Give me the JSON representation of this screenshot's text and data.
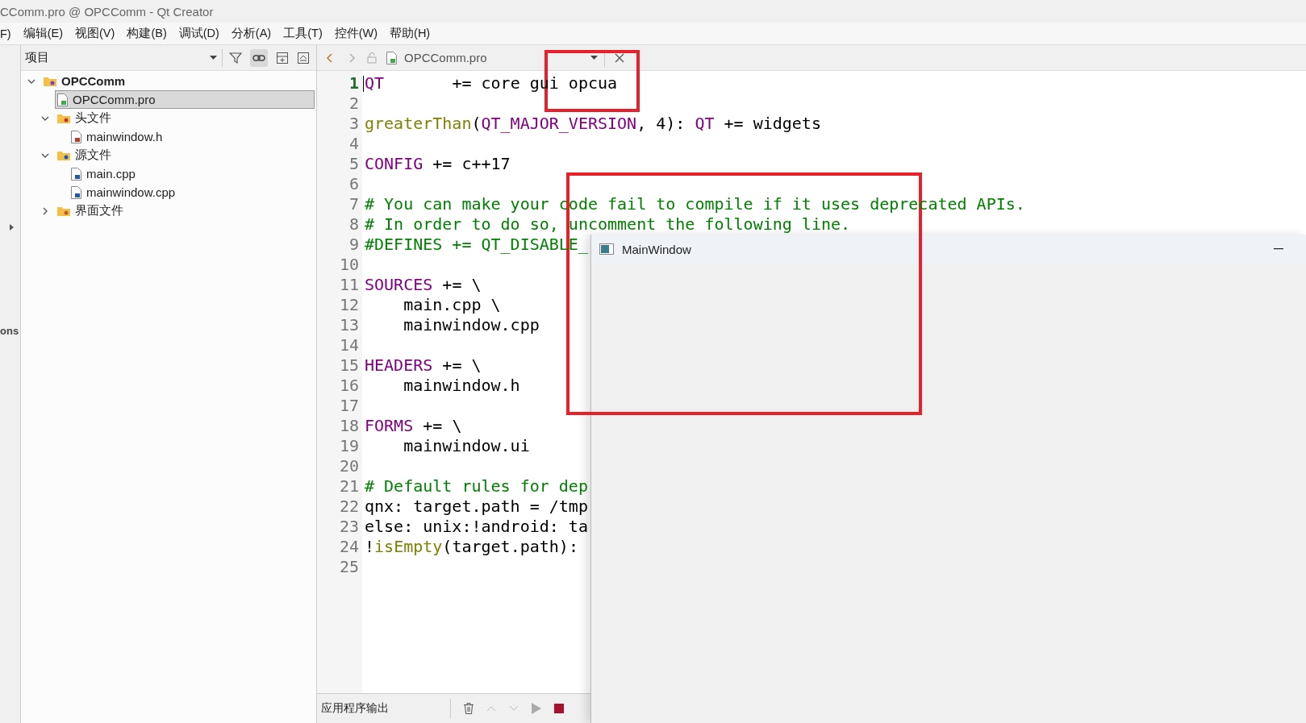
{
  "window": {
    "title": "CComm.pro @ OPCComm - Qt Creator"
  },
  "menu": [
    "F)",
    "编辑(E)",
    "视图(V)",
    "构建(B)",
    "调试(D)",
    "分析(A)",
    "工具(T)",
    "控件(W)",
    "帮助(H)"
  ],
  "mode_bar": {
    "label": "ons"
  },
  "project_panel": {
    "title": "项目",
    "tree": [
      {
        "label": "OPCComm",
        "kind": "project",
        "expanded": true,
        "selected": false,
        "children": [
          {
            "label": "OPCComm.pro",
            "kind": "pro",
            "selected": true
          },
          {
            "label": "头文件",
            "kind": "header-folder",
            "expanded": true,
            "selected": false,
            "children": [
              {
                "label": "mainwindow.h",
                "kind": "header",
                "selected": false
              }
            ]
          },
          {
            "label": "源文件",
            "kind": "source-folder",
            "expanded": true,
            "selected": false,
            "children": [
              {
                "label": "main.cpp",
                "kind": "source",
                "selected": false
              },
              {
                "label": "mainwindow.cpp",
                "kind": "source",
                "selected": false
              }
            ]
          },
          {
            "label": "界面文件",
            "kind": "form-folder",
            "expanded": false,
            "selected": false
          }
        ]
      }
    ]
  },
  "editor": {
    "file": "OPCComm.pro",
    "lines": [
      {
        "n": "1",
        "current": true,
        "tokens": [
          {
            "text": "QT",
            "kind": "keyword"
          },
          {
            "text": "       += core gui opcua",
            "kind": "plain"
          }
        ]
      },
      {
        "n": "2",
        "current": false
      },
      {
        "n": "3",
        "current": false,
        "tokens": [
          {
            "text": "greaterThan",
            "kind": "func"
          },
          {
            "text": "(",
            "kind": "plain"
          },
          {
            "text": "QT_MAJOR_VERSION",
            "kind": "keyword"
          },
          {
            "text": ", 4): ",
            "kind": "plain"
          },
          {
            "text": "QT",
            "kind": "keyword"
          },
          {
            "text": " += widgets",
            "kind": "plain"
          }
        ]
      },
      {
        "n": "4",
        "current": false
      },
      {
        "n": "5",
        "current": false,
        "tokens": [
          {
            "text": "CONFIG",
            "kind": "keyword"
          },
          {
            "text": " += c++17",
            "kind": "plain"
          }
        ]
      },
      {
        "n": "6",
        "current": false
      },
      {
        "n": "7",
        "current": false,
        "tokens": [
          {
            "text": "# You can make your code fail to compile if it uses deprecated APIs.",
            "kind": "comment"
          }
        ]
      },
      {
        "n": "8",
        "current": false,
        "tokens": [
          {
            "text": "# In order to do so, uncomment the following line.",
            "kind": "comment"
          }
        ]
      },
      {
        "n": "9",
        "current": false,
        "tokens": [
          {
            "text": "#DEFINES += QT_DISABLE_",
            "kind": "comment"
          }
        ]
      },
      {
        "n": "10",
        "current": false
      },
      {
        "n": "11",
        "current": false,
        "tokens": [
          {
            "text": "SOURCES",
            "kind": "keyword"
          },
          {
            "text": " += \\",
            "kind": "plain"
          }
        ]
      },
      {
        "n": "12",
        "current": false,
        "tokens": [
          {
            "text": "    main.cpp \\",
            "kind": "plain"
          }
        ]
      },
      {
        "n": "13",
        "current": false,
        "tokens": [
          {
            "text": "    mainwindow.cpp",
            "kind": "plain"
          }
        ]
      },
      {
        "n": "14",
        "current": false
      },
      {
        "n": "15",
        "current": false,
        "tokens": [
          {
            "text": "HEADERS",
            "kind": "keyword"
          },
          {
            "text": " += \\",
            "kind": "plain"
          }
        ]
      },
      {
        "n": "16",
        "current": false,
        "tokens": [
          {
            "text": "    mainwindow.h",
            "kind": "plain"
          }
        ]
      },
      {
        "n": "17",
        "current": false
      },
      {
        "n": "18",
        "current": false,
        "tokens": [
          {
            "text": "FORMS",
            "kind": "keyword"
          },
          {
            "text": " += \\",
            "kind": "plain"
          }
        ]
      },
      {
        "n": "19",
        "current": false,
        "tokens": [
          {
            "text": "    mainwindow.ui",
            "kind": "plain"
          }
        ]
      },
      {
        "n": "20",
        "current": false
      },
      {
        "n": "21",
        "current": false,
        "tokens": [
          {
            "text": "# Default rules for dep",
            "kind": "comment"
          }
        ]
      },
      {
        "n": "22",
        "current": false,
        "tokens": [
          {
            "text": "qnx: target.path = /tmp",
            "kind": "plain"
          }
        ]
      },
      {
        "n": "23",
        "current": false,
        "tokens": [
          {
            "text": "else: unix:!android: ta",
            "kind": "plain"
          }
        ]
      },
      {
        "n": "24",
        "current": false,
        "tokens": [
          {
            "text": "!",
            "kind": "plain"
          },
          {
            "text": "isEmpty",
            "kind": "func"
          },
          {
            "text": "(target.path): ",
            "kind": "plain"
          }
        ]
      },
      {
        "n": "25",
        "current": false
      }
    ]
  },
  "output_pane": {
    "title": "应用程序输出"
  },
  "main_window": {
    "title": "MainWindow"
  }
}
